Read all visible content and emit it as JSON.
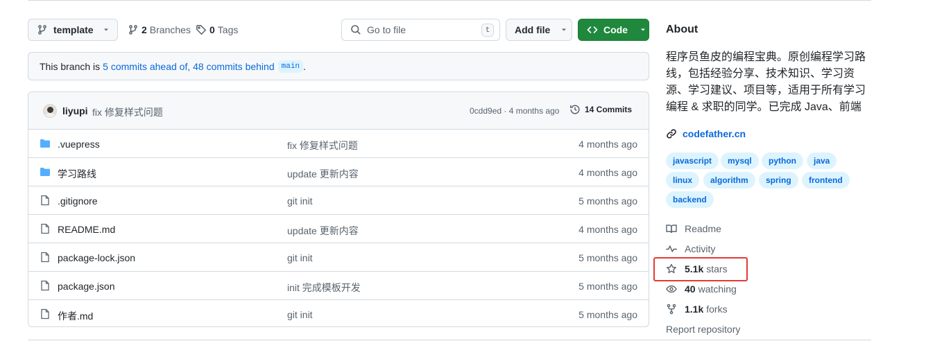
{
  "toolbar": {
    "branch_label": "template",
    "branches_count": "2",
    "branches_label": "Branches",
    "tags_count": "0",
    "tags_label": "Tags",
    "search_placeholder": "Go to file",
    "search_shortcut": "t",
    "add_file_label": "Add file",
    "code_label": "Code"
  },
  "banner": {
    "prefix": "This branch is",
    "link_text": "5 commits ahead of, 48 commits behind",
    "base_branch": "main",
    "suffix": "."
  },
  "latest_commit": {
    "author": "liyupi",
    "message": "fix 修复样式问题",
    "meta": "0cdd9ed · 4 months ago",
    "commits_count": "14 Commits"
  },
  "files": [
    {
      "type": "folder",
      "name": ".vuepress",
      "message": "fix 修复样式问题",
      "age": "4 months ago"
    },
    {
      "type": "folder",
      "name": "学习路线",
      "message": "update 更新内容",
      "age": "4 months ago"
    },
    {
      "type": "file",
      "name": ".gitignore",
      "message": "git init",
      "age": "5 months ago"
    },
    {
      "type": "file",
      "name": "README.md",
      "message": "update 更新内容",
      "age": "4 months ago"
    },
    {
      "type": "file",
      "name": "package-lock.json",
      "message": "git init",
      "age": "5 months ago"
    },
    {
      "type": "file",
      "name": "package.json",
      "message": "init 完成模板开发",
      "age": "5 months ago"
    },
    {
      "type": "file",
      "name": "作者.md",
      "message": "git init",
      "age": "5 months ago"
    }
  ],
  "about": {
    "title": "About",
    "description": "程序员鱼皮的编程宝典。原创编程学习路线，包括经验分享、技术知识、学习资源、学习建议、项目等，适用于所有学习编程 & 求职的同学。已完成 Java、前端",
    "website": "codefather.cn",
    "topics": [
      "javascript",
      "mysql",
      "python",
      "java",
      "linux",
      "algorithm",
      "spring",
      "frontend",
      "backend"
    ],
    "readme_label": "Readme",
    "activity_label": "Activity",
    "stars_count": "5.1k",
    "stars_label": "stars",
    "watching_count": "40",
    "watching_label": "watching",
    "forks_count": "1.1k",
    "forks_label": "forks",
    "report_label": "Report repository"
  },
  "colors": {
    "primary_button": "#1f883d",
    "link": "#0969da",
    "topic_bg": "#ddf4ff",
    "highlight": "#e53935"
  }
}
